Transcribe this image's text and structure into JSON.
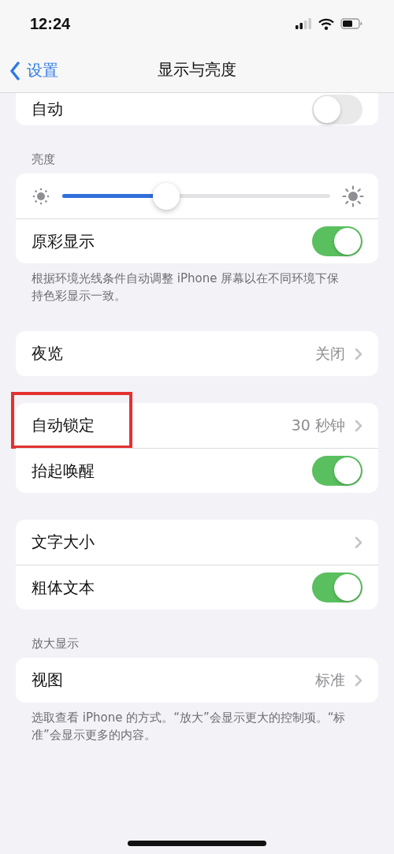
{
  "status_bar": {
    "time": "12:24"
  },
  "nav": {
    "back": "设置",
    "title": "显示与亮度"
  },
  "groups": [
    {
      "cut": true,
      "rows": [
        {
          "kind": "toggle",
          "label": "自动",
          "on": false
        }
      ]
    },
    {
      "header": "亮度",
      "rows": [
        {
          "kind": "slider",
          "level": 0.39
        },
        {
          "kind": "toggle",
          "label": "原彩显示",
          "on": true
        }
      ],
      "footer": "根据环境光线条件自动调整 iPhone 屏幕以在不同环境下保持色彩显示一致。"
    },
    {
      "rows": [
        {
          "kind": "link",
          "label": "夜览",
          "value": "关闭"
        }
      ]
    },
    {
      "rows": [
        {
          "kind": "link",
          "label": "自动锁定",
          "value": "30 秒钟",
          "highlighted": true
        },
        {
          "kind": "toggle",
          "label": "抬起唤醒",
          "on": true
        }
      ]
    },
    {
      "rows": [
        {
          "kind": "link",
          "label": "文字大小"
        },
        {
          "kind": "toggle",
          "label": "粗体文本",
          "on": true
        }
      ]
    },
    {
      "header": "放大显示",
      "rows": [
        {
          "kind": "link",
          "label": "视图",
          "value": "标准"
        }
      ],
      "footer": "选取查看 iPhone 的方式。“放大”会显示更大的控制项。“标准”会显示更多的内容。"
    }
  ]
}
